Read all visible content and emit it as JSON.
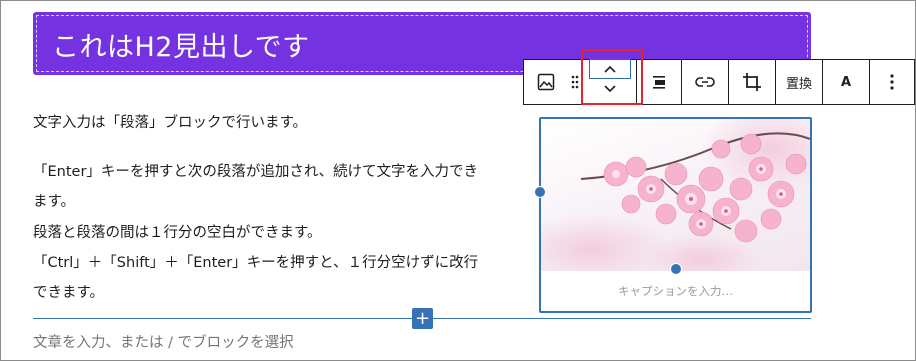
{
  "heading": {
    "text": "これはH2見出しです",
    "background": "#7432e0"
  },
  "toolbar": {
    "buttons": [
      {
        "name": "image-icon",
        "label": ""
      },
      {
        "name": "drag-handle-icon",
        "label": ""
      },
      {
        "name": "move-up-icon",
        "label": ""
      },
      {
        "name": "move-down-icon",
        "label": ""
      },
      {
        "name": "align-icon",
        "label": ""
      },
      {
        "name": "link-icon",
        "label": ""
      },
      {
        "name": "crop-icon",
        "label": ""
      },
      {
        "name": "replace-button",
        "label": "置換"
      },
      {
        "name": "text-format-button",
        "label": "A"
      },
      {
        "name": "more-options-icon",
        "label": ""
      }
    ],
    "highlight_color": "#e3262e",
    "accent": "#3673b4"
  },
  "paragraphs": [
    "文字入力は「段落」ブロックで行います。",
    "「Enter」キーを押すと次の段落が追加され、続けて文字を入力でき",
    "ます。",
    "段落と段落の間は１行分の空白ができます。",
    "「Ctrl」＋「Shift」＋「Enter」キーを押すと、１行分空けずに改行",
    "できます。"
  ],
  "image_block": {
    "caption_placeholder": "キャプションを入力…",
    "image_subject": "pink cherry blossoms"
  },
  "inserter": {
    "label": "+"
  },
  "placeholder": "文章を入力、または / でブロックを選択"
}
